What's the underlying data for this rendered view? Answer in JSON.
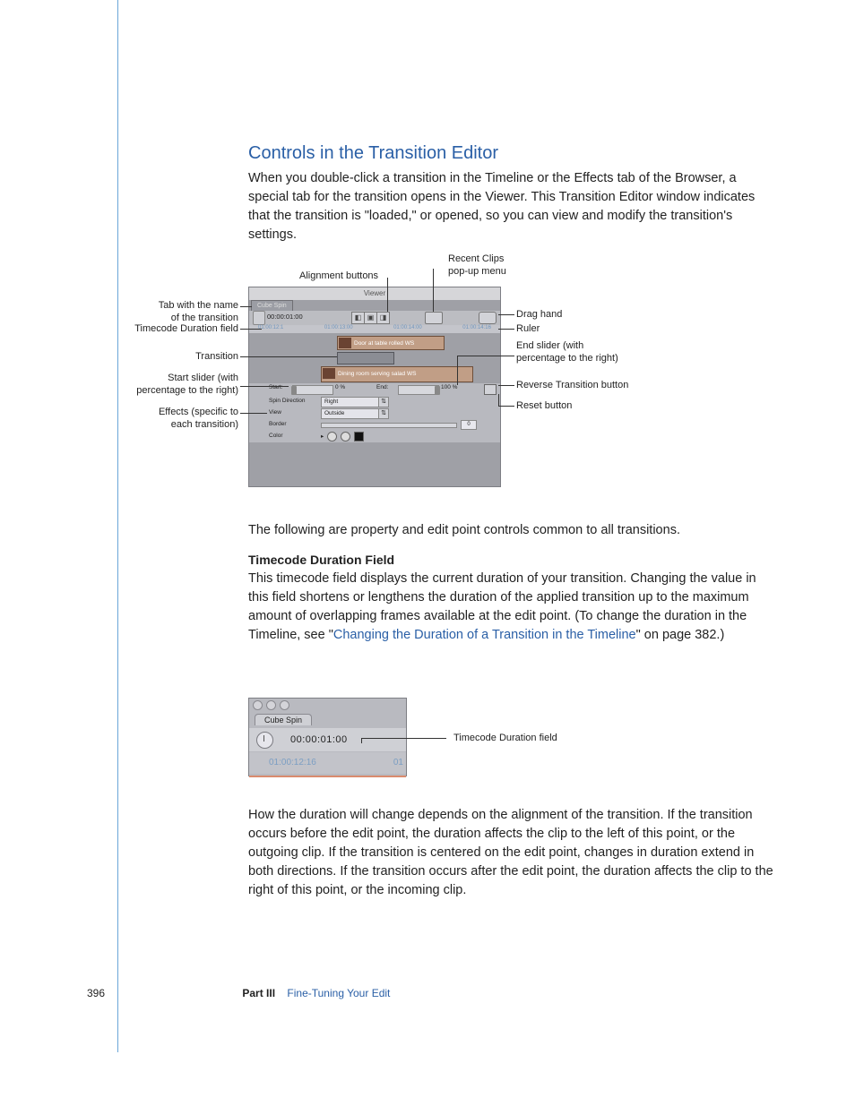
{
  "title": "Controls in the Transition Editor",
  "intro": "When you double-click a transition in the Timeline or the Effects tab of the Browser, a special tab for the transition opens in the Viewer. This Transition Editor window indicates that the transition is \"loaded,\" or opened, so you can view and modify the transition's settings.",
  "followup": "The following are property and edit point controls common to all transitions.",
  "sub1": "Timecode Duration Field",
  "sub1_body_a": "This timecode field displays the current duration of your transition. Changing the value in this field shortens or lengthens the duration of the applied transition up to the maximum amount of overlapping frames available at the edit point. (To change the duration in the Timeline, see \"",
  "sub1_link": "Changing the Duration of a Transition in the Timeline",
  "sub1_body_b": "\" on page 382.)",
  "after2": "How the duration will change depends on the alignment of the transition. If the transition occurs before the edit point, the duration affects the clip to the left of this point, or the outgoing clip. If the transition is centered on the edit point, changes in duration extend in both directions. If the transition occurs after the edit point, the duration affects the clip to the right of this point, or the incoming clip.",
  "callouts": {
    "tab_name": "Tab with the name\nof the transition",
    "tc_dur": "Timecode Duration field",
    "transition": "Transition",
    "start_slider": "Start slider (with\npercentage to the right)",
    "effects": "Effects (specific to\neach transition)",
    "align": "Alignment buttons",
    "recent": "Recent Clips\npop-up menu",
    "drag": "Drag hand",
    "ruler": "Ruler",
    "end_slider": "End slider (with\npercentage to the right)",
    "reverse": "Reverse Transition button",
    "reset": "Reset button",
    "tc_dur2": "Timecode Duration field"
  },
  "diagram": {
    "window_title": "Viewer",
    "tab": "Cube Spin",
    "tc": "00:00:01:00",
    "ruler": [
      "01:00:12:1",
      "01:00:13:00",
      "01:00:14:00",
      "01:00:14:16"
    ],
    "clip1": "Door at table rolled WS",
    "clip2": "Dining room serving salad WS",
    "start_label": "Start:",
    "start_pct": "0 %",
    "end_label": "End:",
    "end_pct": "100 %",
    "eff": {
      "spin_label": "Spin Direction",
      "spin_val": "Right",
      "view_label": "View",
      "view_val": "Outside",
      "border_label": "Border",
      "border_val": "0",
      "color_label": "Color"
    }
  },
  "diagram2": {
    "tab": "Cube Spin",
    "tc": "00:00:01:00",
    "ruler_left": "01:00:12:16",
    "ruler_right": "01"
  },
  "footer": {
    "page": "396",
    "part": "Part III",
    "title": "Fine-Tuning Your Edit"
  }
}
